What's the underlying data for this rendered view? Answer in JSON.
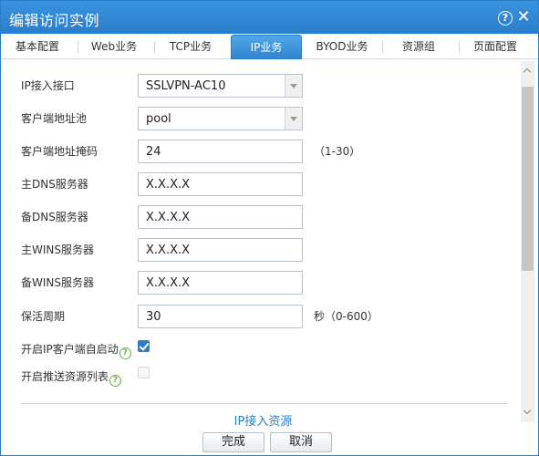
{
  "window": {
    "title": "编辑访问实例",
    "help": "?",
    "close": "✕"
  },
  "tabs": [
    {
      "label": "基本配置"
    },
    {
      "label": "Web业务"
    },
    {
      "label": "TCP业务"
    },
    {
      "label": "IP业务"
    },
    {
      "label": "BYOD业务"
    },
    {
      "label": "资源组"
    },
    {
      "label": "页面配置"
    }
  ],
  "active_tab": "IP业务",
  "form": {
    "ip_interface": {
      "label": "IP接入接口",
      "value": "SSLVPN-AC10"
    },
    "client_pool": {
      "label": "客户端地址池",
      "value": "pool"
    },
    "client_mask": {
      "label": "客户端地址掩码",
      "value": "24",
      "hint": "（1-30）"
    },
    "primary_dns": {
      "label": "主DNS服务器",
      "value": "X.X.X.X"
    },
    "backup_dns": {
      "label": "备DNS服务器",
      "value": "X.X.X.X"
    },
    "primary_wins": {
      "label": "主WINS服务器",
      "value": "X.X.X.X"
    },
    "backup_wins": {
      "label": "备WINS服务器",
      "value": "X.X.X.X"
    },
    "keepalive": {
      "label": "保活周期",
      "value": "30",
      "hint": "秒（0-600）"
    },
    "auto_start": {
      "label": "开启IP客户端自启动",
      "checked": true
    },
    "push_resources": {
      "label": "开启推送资源列表",
      "checked": false,
      "disabled": true
    }
  },
  "help_mark": "?",
  "section_link": "IP接入资源",
  "buttons": {
    "ok": "完成",
    "cancel": "取消"
  },
  "colors": {
    "titlebar": "#2e86d4",
    "accent": "#2a7fcc",
    "help_green": "#6bb33a"
  }
}
